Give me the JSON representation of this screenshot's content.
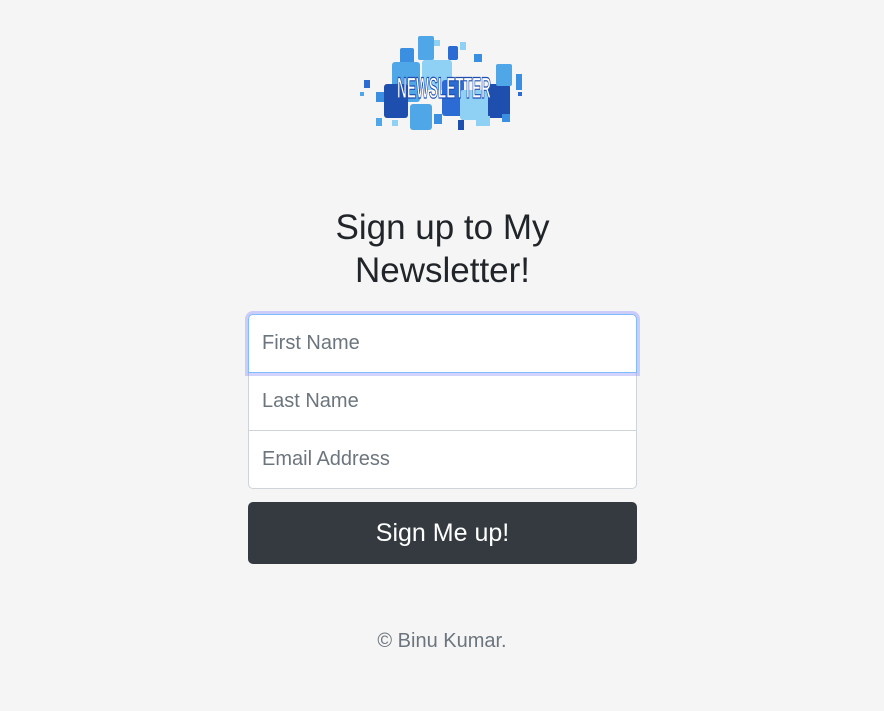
{
  "logo": {
    "text": "NEWSLETTER",
    "colors": [
      "#1f4fae",
      "#2c6bd4",
      "#4fa7e8",
      "#8fd0f5",
      "#3b8fe0"
    ]
  },
  "heading": {
    "text": "Sign up to My Newsletter!"
  },
  "form": {
    "first_name": {
      "placeholder": "First Name",
      "value": ""
    },
    "last_name": {
      "placeholder": "Last Name",
      "value": ""
    },
    "email": {
      "placeholder": "Email Address",
      "value": ""
    },
    "submit_label": "Sign Me up!"
  },
  "footer": {
    "text": "© Binu Kumar."
  },
  "colors": {
    "background": "#f5f5f5",
    "button": "#343a40",
    "focus_ring": "#8080ff"
  }
}
